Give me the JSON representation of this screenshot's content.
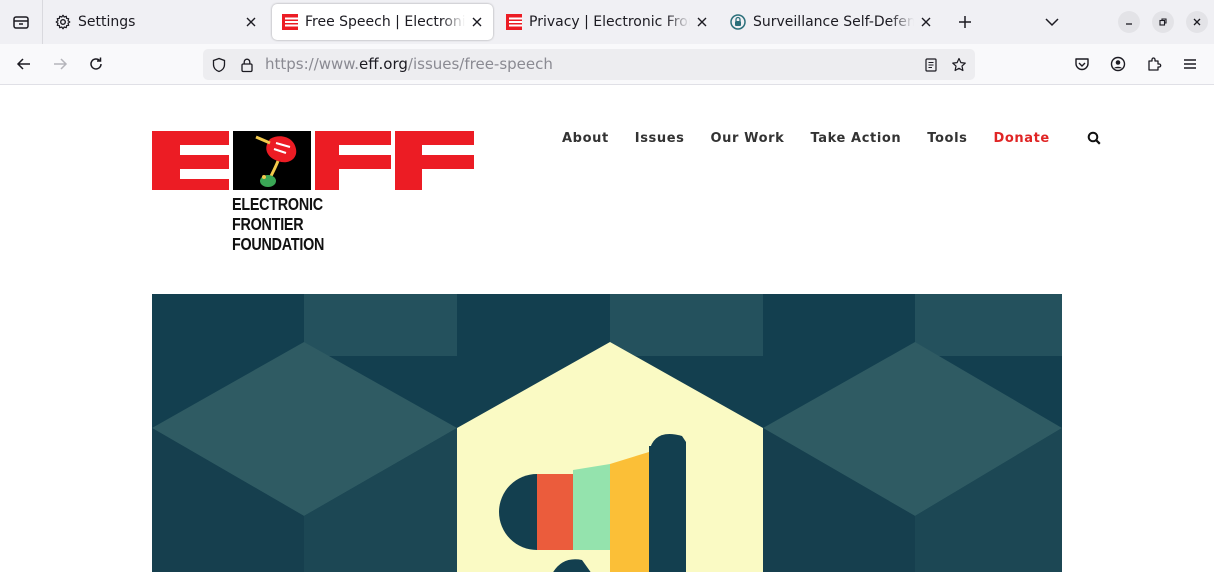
{
  "browser": {
    "tabs": [
      {
        "title": "Settings",
        "icon": "gear-icon",
        "active": false
      },
      {
        "title": "Free Speech | Electronic Frontier Foundation",
        "icon": "eff-favicon",
        "active": true
      },
      {
        "title": "Privacy | Electronic Frontier Foundation",
        "icon": "eff-favicon",
        "active": false
      },
      {
        "title": "Surveillance Self-Defense",
        "icon": "ssd-favicon",
        "active": false
      }
    ],
    "url": {
      "prefix": "https://www.",
      "domain": "eff.org",
      "path": "/issues/free-speech"
    }
  },
  "site": {
    "logo": {
      "letters": "EFF",
      "wordmark": [
        "ELECTRONIC",
        "FRONTIER",
        "FOUNDATION"
      ],
      "colors": {
        "red": "#ec1c24",
        "black": "#000000"
      }
    },
    "nav": {
      "about": "About",
      "issues": "Issues",
      "our_work": "Our Work",
      "take_action": "Take Action",
      "tools": "Tools",
      "donate": "Donate"
    },
    "colors": {
      "donate": "#e02525",
      "hero_dark": "#133f4f",
      "hero_mid": "#2f5b63",
      "hero_cream": "#fafac4",
      "megaphone_red": "#eb5c3c",
      "megaphone_green": "#94e3ad",
      "megaphone_yellow": "#fbbf37"
    }
  }
}
